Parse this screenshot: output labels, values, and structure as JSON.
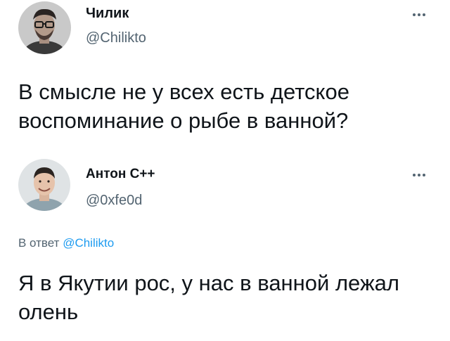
{
  "tweets": [
    {
      "display_name": "Чилик",
      "handle": "@Chilikto",
      "text": "В смысле не у всех есть детское воспоминание о рыбе в ванной?",
      "more_icon": "more-horizontal-icon"
    },
    {
      "display_name": "Антон С++",
      "handle": "@0xfe0d",
      "reply_prefix": "В ответ",
      "reply_handle": "@Chilikto",
      "text": "Я в Якутии рос, у нас в ванной лежал олень",
      "more_icon": "more-horizontal-icon"
    }
  ],
  "colors": {
    "text_primary": "#0f1419",
    "text_secondary": "#536471",
    "link": "#1d9bf0",
    "background": "#ffffff"
  }
}
